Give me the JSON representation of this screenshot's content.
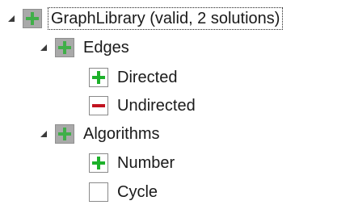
{
  "tree": {
    "root": {
      "label": "GraphLibrary (valid, 2 solutions)",
      "state": "partial",
      "children": [
        {
          "label": "Edges",
          "state": "partial",
          "children": [
            {
              "label": "Directed",
              "state": "included"
            },
            {
              "label": "Undirected",
              "state": "excluded"
            }
          ]
        },
        {
          "label": "Algorithms",
          "state": "partial",
          "children": [
            {
              "label": "Number",
              "state": "included"
            },
            {
              "label": "Cycle",
              "state": "unchecked"
            }
          ]
        }
      ]
    }
  },
  "colors": {
    "plus": "#1db12a",
    "minus": "#c1121f",
    "partial_bg": "#a9a9a9",
    "border": "#8a8a8a"
  }
}
